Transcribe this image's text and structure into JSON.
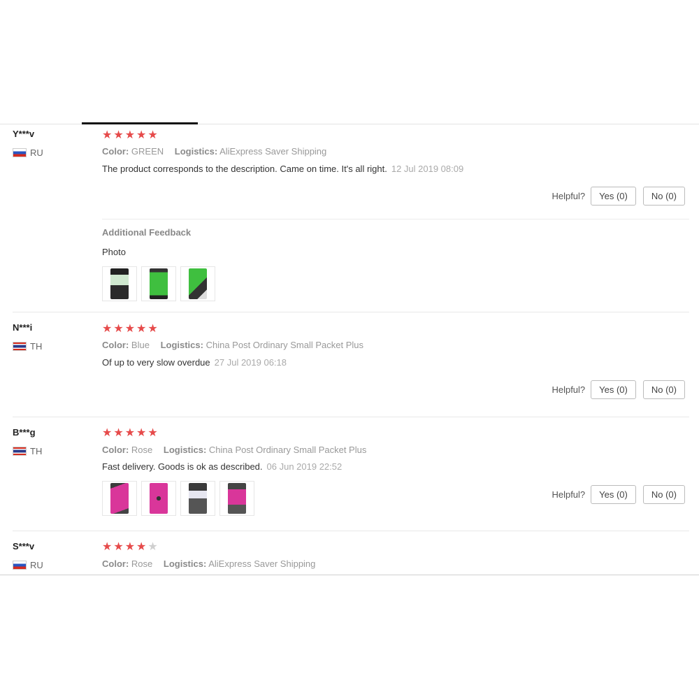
{
  "helpful_label": "Helpful?",
  "reviews": [
    {
      "user": "Y***v",
      "country": "RU",
      "rating": 5,
      "color_label": "Color:",
      "color": "GREEN",
      "logistics_label": "Logistics:",
      "logistics": "AliExpress Saver Shipping",
      "text": "The product corresponds to the description. Came on time. It's all right.",
      "date": "12 Jul 2019 08:09",
      "yes": "Yes (0)",
      "no": "No (0)",
      "additional_feedback": "Additional Feedback",
      "photo_label": "Photo",
      "photos": [
        "green-case-photo-1",
        "green-case-photo-2",
        "green-case-photo-3"
      ]
    },
    {
      "user": "N***i",
      "country": "TH",
      "rating": 5,
      "color_label": "Color:",
      "color": "Blue",
      "logistics_label": "Logistics:",
      "logistics": "China Post Ordinary Small Packet Plus",
      "text": "Of up to very slow overdue",
      "date": "27 Jul 2019 06:18",
      "yes": "Yes (0)",
      "no": "No (0)"
    },
    {
      "user": "B***g",
      "country": "TH",
      "rating": 5,
      "color_label": "Color:",
      "color": "Rose",
      "logistics_label": "Logistics:",
      "logistics": "China Post Ordinary Small Packet Plus",
      "text": "Fast delivery. Goods is ok as described.",
      "date": "06 Jun 2019 22:52",
      "yes": "Yes (0)",
      "no": "No (0)",
      "photos": [
        "rose-case-photo-1",
        "rose-case-photo-2",
        "rose-case-photo-3",
        "rose-case-photo-4"
      ]
    },
    {
      "user": "S***v",
      "country": "RU",
      "rating": 4,
      "color_label": "Color:",
      "color": "Rose",
      "logistics_label": "Logistics:",
      "logistics": "AliExpress Saver Shipping"
    }
  ],
  "colors": {
    "star": "#e64a4a",
    "star_off": "#cfcfcf",
    "green_case": "#3fbf3f",
    "rose_case": "#d9369a"
  }
}
